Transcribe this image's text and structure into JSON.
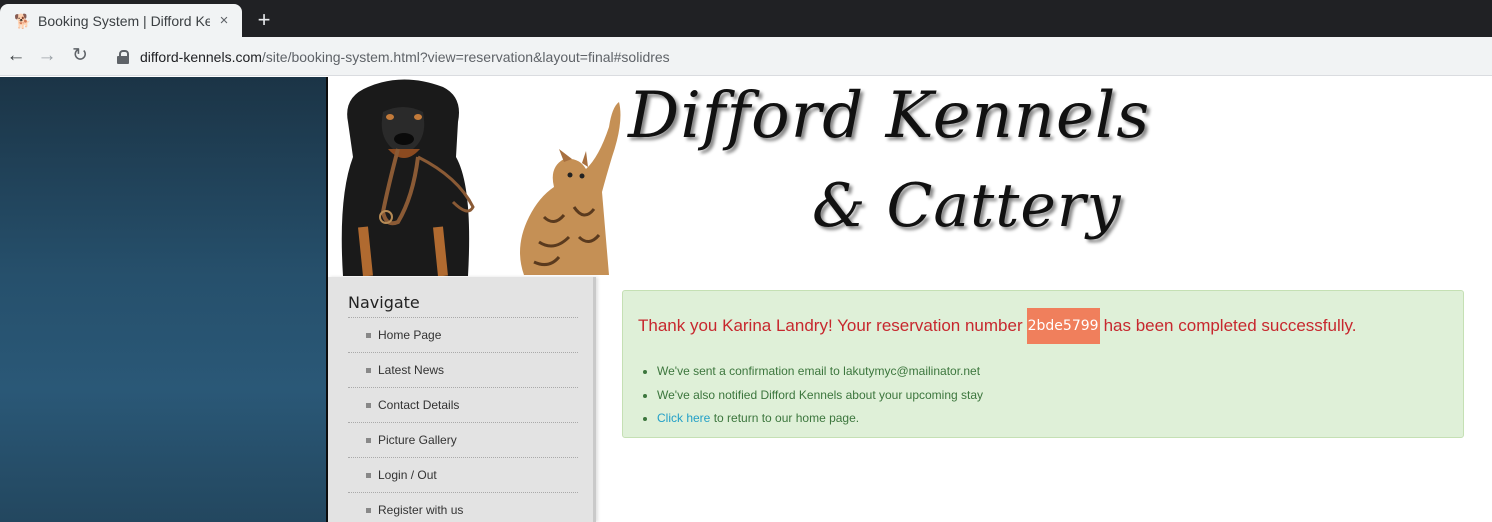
{
  "browser": {
    "tab_title": "Booking System | Difford Kennels & Cattery",
    "tab_close": "×",
    "new_tab": "+",
    "url_host": "difford-kennels.com",
    "url_path": "/site/booking-system.html?view=reservation&layout=final#solidres"
  },
  "header": {
    "logo_line1": "Difford Kennels",
    "logo_line2": "& Cattery"
  },
  "sidebar": {
    "heading": "Navigate",
    "items": [
      {
        "label": "Home Page"
      },
      {
        "label": "Latest News"
      },
      {
        "label": "Contact Details"
      },
      {
        "label": "Picture Gallery"
      },
      {
        "label": "Login / Out"
      },
      {
        "label": "Register with us"
      }
    ]
  },
  "confirmation": {
    "title_prefix": "Thank you Karina Landry! Your reservation number",
    "reservation_number": "2bde5799",
    "title_suffix": "has been completed successfully.",
    "bullets": [
      "We've sent a confirmation email to lakutymyc@mailinator.net",
      "We've also notified Difford Kennels about your upcoming stay"
    ],
    "link_text": "Click here",
    "link_suffix": " to return to our home page."
  },
  "colors": {
    "success_bg": "#dff0d8",
    "title_red": "#c7282e",
    "badge": "#f07f5c",
    "link": "#23a0c7"
  }
}
